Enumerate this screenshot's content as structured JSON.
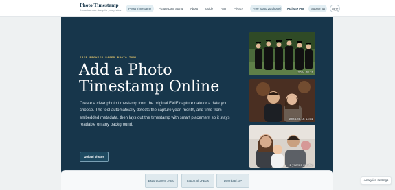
{
  "brand": {
    "title": "Photo Timestamp",
    "tagline": "A practical date stamp for your photos"
  },
  "nav": {
    "items": [
      {
        "label": "Photo Timestamp",
        "active": true
      },
      {
        "label": "Picture Date Stamp"
      },
      {
        "label": "About"
      },
      {
        "label": "Guide"
      },
      {
        "label": "FAQ"
      },
      {
        "label": "Privacy"
      }
    ],
    "free_label": "Free (up to 20 photos)",
    "pro_label": "Activate Pro",
    "support_label": "Support us",
    "lang_label": "中文"
  },
  "hero": {
    "eyebrow": "FREE BROWSER-BASED PHOTO TOOL",
    "title": "Add a Photo Timestamp Online",
    "description": "Create a clear photo timestamp from the original EXIF capture date or a date you choose. The tool automatically detects the capture year, month, and time from embedded metadata, then lays out the timestamp with smart placement so it stays readable on any background.",
    "upload_label": "Upload photos"
  },
  "samples": [
    {
      "stamp": "2024.08.15"
    },
    {
      "stamp": "2024.08.15 14:32"
    },
    {
      "stamp": "2 years 3 months"
    }
  ],
  "toolbar": {
    "export_current": "Export current JPEG",
    "export_all": "Export all JPEGs",
    "download_zip": "Download ZIP"
  },
  "analytics_label": "Analytics settings",
  "colors": {
    "hero_bg": "#17364b",
    "eyebrow": "#e2c56c",
    "nav_active_bg": "#e2eef3"
  }
}
